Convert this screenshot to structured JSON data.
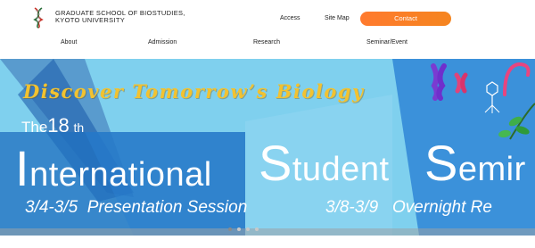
{
  "header": {
    "logo_icon": "dna-helix-icon",
    "school_name_line1": "GRADUATE SCHOOL OF BIOSTUDIES,",
    "school_name_line2": "KYOTO UNIVERSITY",
    "util_nav": {
      "access": "Access",
      "sitemap": "Site Map"
    },
    "contact_label": "Contact",
    "contact_color": "#f5851f",
    "main_nav": [
      {
        "label": "About"
      },
      {
        "label": "Admission"
      },
      {
        "label": "Research"
      },
      {
        "label": "Seminar/Event"
      }
    ]
  },
  "hero": {
    "tagline": "Discover Tomorrow’s Biology",
    "edition_prefix": "The",
    "edition_number": "18",
    "edition_suffix": "th",
    "title_word1_initial": "I",
    "title_word1_rest": "nternational",
    "title_word2_initial": "S",
    "title_word2_rest": "tudent",
    "title_word3_initial": "S",
    "title_word3_rest": "emir",
    "dates_1": "3/4-3/5",
    "session_1": "Presentation Session",
    "dates_2": "3/8-3/9",
    "session_2": "Overnight Re",
    "colors": {
      "sky": "#7fd0ee",
      "dark_blue": "#1f5fae",
      "mid_blue": "#2f86d6",
      "tagline_gold": "#f2c230"
    }
  },
  "slider": {
    "dot_count": 4,
    "active_index": 0
  }
}
